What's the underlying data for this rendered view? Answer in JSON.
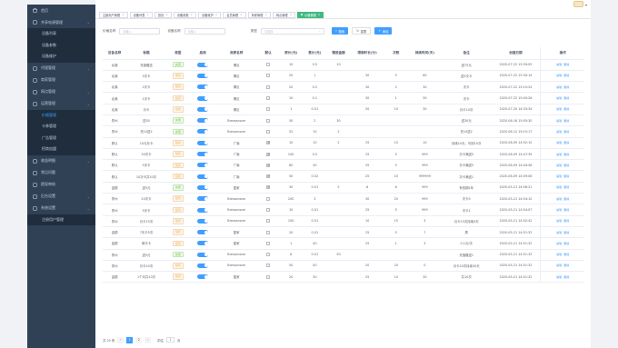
{
  "sidebar": {
    "items": [
      {
        "label": "首页",
        "icon": "home-icon",
        "type": "item"
      },
      {
        "label": "共享电源管理",
        "icon": "power-icon",
        "type": "group"
      },
      {
        "label": "设备列表",
        "type": "sub"
      },
      {
        "label": "设备参数",
        "type": "sub"
      },
      {
        "label": "设备维护",
        "type": "sub"
      },
      {
        "label": "代理管理",
        "icon": "agent-icon",
        "type": "group"
      },
      {
        "label": "商家管理",
        "icon": "shop-icon",
        "type": "item"
      },
      {
        "label": "网点管理",
        "icon": "network-icon",
        "type": "group"
      },
      {
        "label": "运营管理",
        "icon": "operation-icon",
        "type": "group"
      },
      {
        "label": "价格管理",
        "type": "sub",
        "active": true
      },
      {
        "label": "卡券管理",
        "type": "sub"
      },
      {
        "label": "广告管理",
        "type": "sub"
      },
      {
        "label": "招商加盟",
        "type": "sub"
      },
      {
        "label": "收益明细",
        "icon": "money-icon",
        "type": "group"
      },
      {
        "label": "常见问题",
        "icon": "question-icon",
        "type": "item"
      },
      {
        "label": "提现审核",
        "icon": "withdraw-icon",
        "type": "item"
      },
      {
        "label": "后台设置",
        "icon": "settings-icon",
        "type": "group"
      },
      {
        "label": "系统设置",
        "icon": "gear-icon",
        "type": "group"
      },
      {
        "label": "注册用户管理",
        "type": "sub"
      }
    ]
  },
  "tags": [
    {
      "label": "注册用户管理"
    },
    {
      "label": "设备列表"
    },
    {
      "label": "首页"
    },
    {
      "label": "设备参数"
    },
    {
      "label": "设备维护"
    },
    {
      "label": "会员管理"
    },
    {
      "label": "商家管理"
    },
    {
      "label": "网点管理"
    },
    {
      "label": "价格管理",
      "active": true
    }
  ],
  "filters": {
    "title_label": "价格名称",
    "title_placeholder": "请输入",
    "device_label": "设备名称",
    "device_placeholder": "请输入",
    "type_label": "类型",
    "type_placeholder": "请选择",
    "search_btn": "搜索",
    "reset_btn": "重置",
    "add_btn": "添加"
  },
  "table": {
    "columns": [
      "设备名称",
      "标题",
      "类型",
      "启用",
      "商家名称",
      "默认",
      "原价(元)",
      "售价(元)",
      "赠送金额",
      "限制时长(分)",
      "次数",
      "持续时间(天)",
      "备注",
      "创建日期",
      "操作"
    ],
    "rows": [
      [
        "北典",
        "充值赠送",
        "充值",
        "on",
        "哪巨",
        "",
        "10",
        "0.5",
        "10",
        "",
        "",
        "",
        "送75元",
        "2020-07-22 15:39:05"
      ],
      [
        "北典",
        "5次卡",
        "包月",
        "on",
        "哪巨",
        "",
        "20",
        "1",
        "",
        "30",
        "5",
        "60",
        "送5次卡",
        "2020-07-22 15:30:14"
      ],
      [
        "北典",
        "2次卡",
        "包月",
        "on",
        "哪巨",
        "",
        "20",
        "0.2",
        "",
        "30",
        "2",
        "30",
        "次卡",
        "2020-07-22 15:10:24"
      ],
      [
        "北典",
        "1次卡",
        "包月",
        "on",
        "哪巨",
        "",
        "10",
        "0.1",
        "",
        "30",
        "1",
        "30",
        "次卡",
        "2020-07-22 15:00:26"
      ],
      [
        "北典",
        "月卡",
        "包月",
        "on",
        "哪巨",
        "",
        "1",
        "0.01",
        "",
        "20",
        "10",
        "30",
        "月卡10次",
        "2020-07-20 14:33:34"
      ],
      [
        "郑州",
        "送30",
        "充值",
        "on",
        "Bressanone",
        "",
        "50",
        "2",
        "30",
        "",
        "",
        "",
        "送30元",
        "2020-06-16 15:05:30"
      ],
      [
        "郑州",
        "充10送2",
        "充值",
        "on",
        "Bressanone",
        "",
        "52",
        "10",
        "2",
        "",
        "",
        "",
        "充10送2",
        "2020-06-12 19:15:17"
      ],
      [
        "默认",
        "10元月卡",
        "包月",
        "on",
        "广南",
        "✔",
        "10",
        "10",
        "2",
        "25",
        "10",
        "10",
        "持续10天，可用10次",
        "2020-06-09 14:52:10"
      ],
      [
        "默认",
        "30次卡",
        "包月",
        "on",
        "广南",
        "✔",
        "100",
        "0.5",
        "",
        "25",
        "5",
        "999",
        "次卡满送5",
        "2020-06-09 14:47:39"
      ],
      [
        "默认",
        "5次卡",
        "包月",
        "on",
        "广南",
        "✔",
        "60",
        "30",
        "",
        "25",
        "5",
        "999",
        "次卡满送5",
        "2020-06-09 14:44:58"
      ],
      [
        "默认",
        "10次卡并10次",
        "包月",
        "on",
        "广南",
        "✔",
        "50",
        "0.02",
        "",
        "25",
        "10",
        "999999",
        "次卡满送1",
        "2020-06-09 14:09:08"
      ],
      [
        "金额",
        "送5元",
        "充值",
        "on",
        "盈家",
        "✔",
        "30",
        "0.01",
        "5",
        "6",
        "6",
        "999",
        "有效期1年",
        "2020-05-21 14:56:21"
      ],
      [
        "郑州",
        "20次卡",
        "包月",
        "on",
        "Bressanone",
        "",
        "200",
        "3",
        "",
        "30",
        "20",
        "999",
        "次卡5",
        "2020-05-21 14:54:10"
      ],
      [
        "郑州",
        "5次卡",
        "包月",
        "on",
        "Bressanone",
        "",
        "10",
        "0.01",
        "",
        "25",
        "5",
        "999",
        "次卡1",
        "2020-05-21 14:54:07"
      ],
      [
        "郑州",
        "月卡15次",
        "包月",
        "on",
        "Bressanone",
        "",
        "100",
        "0.01",
        "",
        "10",
        "15",
        "3",
        "月卡15次持续5天",
        "2020-05-21 14:52:42"
      ],
      [
        "金额",
        "7天卡5次",
        "包月",
        "on",
        "盈家",
        "",
        "20",
        "0.01",
        "",
        "25",
        "5",
        "7",
        "周",
        "2020-05-21 14:51:32"
      ],
      [
        "金额",
        "单次卡",
        "包月",
        "on",
        "盈家",
        "",
        "1",
        "40",
        "",
        "25",
        "1",
        "3",
        "0.1元/次",
        "2020-05-21 14:51:32"
      ],
      [
        "郑州",
        "送5元",
        "充值",
        "on",
        "Bressanone",
        "",
        "6",
        "0.01",
        "50",
        "",
        "",
        "",
        "充值赠送1",
        "2020-05-21 14:51:32"
      ],
      [
        "郑州",
        "月卡20次",
        "包月",
        "on",
        "Bressanone",
        "",
        "50",
        "50",
        "",
        "20",
        "20",
        "0",
        "月卡20次持续30天",
        "2020-05-21 14:51:32"
      ],
      [
        "金额",
        "1个月共10次",
        "包月",
        "on",
        "盈家",
        "",
        "20",
        "30",
        "",
        "25",
        "10",
        "30",
        "共10次",
        "2020-05-21 14:51:32"
      ]
    ],
    "op_edit": "编辑",
    "op_delete": "删除"
  },
  "pager": {
    "total": "共 20 条",
    "pages": [
      "1",
      "2"
    ],
    "current": "1",
    "goto_label": "前往",
    "goto_value": "1",
    "page_suffix": "页"
  },
  "colors": {
    "sidebar_bg": "#304156",
    "accent": "#409eff",
    "tag_active": "#42b983"
  }
}
